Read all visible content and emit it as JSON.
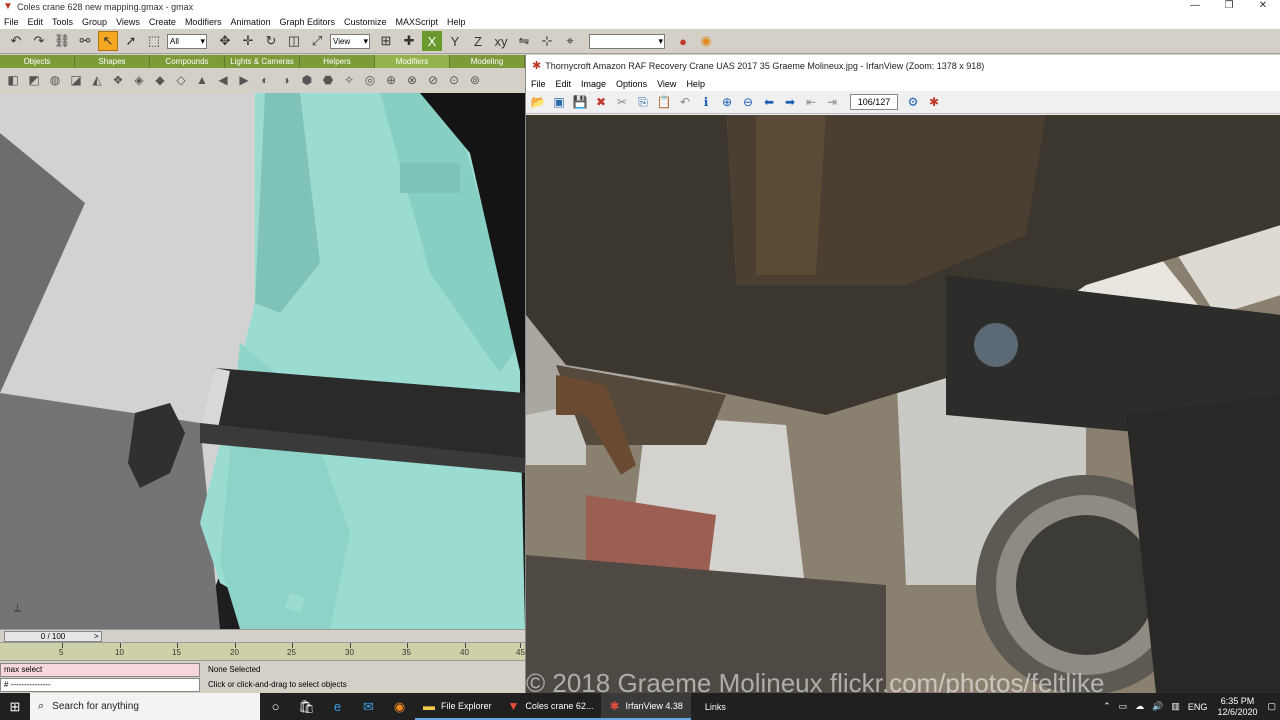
{
  "gmax": {
    "title": "Coles crane 628 new mapping.gmax - gmax",
    "menu": [
      "File",
      "Edit",
      "Tools",
      "Group",
      "Views",
      "Create",
      "Modifiers",
      "Animation",
      "Graph Editors",
      "Customize",
      "MAXScript",
      "Help"
    ],
    "selection_filter": "All",
    "coord_system": "View",
    "tabs": [
      "Objects",
      "Shapes",
      "Compounds",
      "Lights & Cameras",
      "Helpers",
      "Modifiers",
      "Modeling"
    ],
    "timeslider": {
      "label": "0 / 100",
      "right_arrow": ">"
    },
    "timeline_ticks": [
      "5",
      "10",
      "15",
      "20",
      "25",
      "30",
      "35",
      "40",
      "45"
    ],
    "status": {
      "script": "max select",
      "listener": "# ---------------",
      "selection": "None Selected",
      "prompt": "Click or click-and-drag to select objects"
    }
  },
  "window_controls": {
    "min": "—",
    "max": "❐",
    "close": "✕"
  },
  "irfanview": {
    "title": "Thornycroft Amazon RAF Recovery Crane UAS 2017 35 Graeme Molineux.jpg - IrfanView (Zoom: 1378 x 918)",
    "menu": [
      "File",
      "Edit",
      "Image",
      "Options",
      "View",
      "Help"
    ],
    "counter": "106/127",
    "watermark": "© 2018 Graeme Molineux flickr.com/photos/feltlike"
  },
  "taskbar": {
    "search_placeholder": "Search for anything",
    "apps": [
      {
        "label": "File Explorer"
      },
      {
        "label": "Coles crane 62..."
      },
      {
        "label": "IrfanView 4.38"
      },
      {
        "label": "Links"
      }
    ],
    "language": "ENG",
    "time": "6:35 PM",
    "date": "12/6/2020"
  },
  "colors": {
    "accent_green": "#7e9b3a",
    "model_cyan": "#9bdcd0",
    "taskbar": "#202020"
  }
}
